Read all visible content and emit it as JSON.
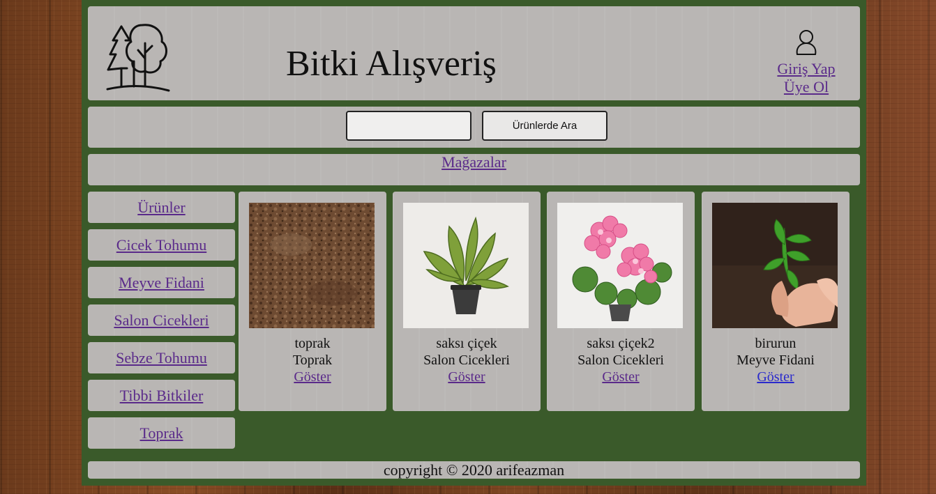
{
  "header": {
    "title": "Bitki Alışveriş",
    "login_label": "Giriş Yap",
    "register_label": "Üye Ol"
  },
  "search": {
    "value": "",
    "button_label": "Ürünlerde Ara"
  },
  "nav": {
    "stores_label": "Mağazalar"
  },
  "sidebar": {
    "items": [
      {
        "label": "Ürünler"
      },
      {
        "label": "Cicek Tohumu"
      },
      {
        "label": "Meyve Fidani"
      },
      {
        "label": "Salon Cicekleri"
      },
      {
        "label": "Sebze Tohumu"
      },
      {
        "label": "Tibbi Bitkiler"
      },
      {
        "label": "Toprak"
      }
    ]
  },
  "products": [
    {
      "name": "toprak",
      "category": "Toprak",
      "link": "Göster",
      "image_icon": "soil-image"
    },
    {
      "name": "saksı çiçek",
      "category": "Salon Cicekleri",
      "link": "Göster",
      "image_icon": "potted-plant-image"
    },
    {
      "name": "saksı çiçek2",
      "category": "Salon Cicekleri",
      "link": "Göster",
      "image_icon": "pink-flower-image"
    },
    {
      "name": "birurun",
      "category": "Meyve Fidani",
      "link": "Göster",
      "image_icon": "seedling-in-hands-image"
    }
  ],
  "footer": {
    "copyright": "copyright © 2020 arifeazman"
  },
  "colors": {
    "frame": "#3a5a2a",
    "panel": "#b9b6b4",
    "visited_link": "#5a2a8a",
    "link": "#2a2acc"
  }
}
